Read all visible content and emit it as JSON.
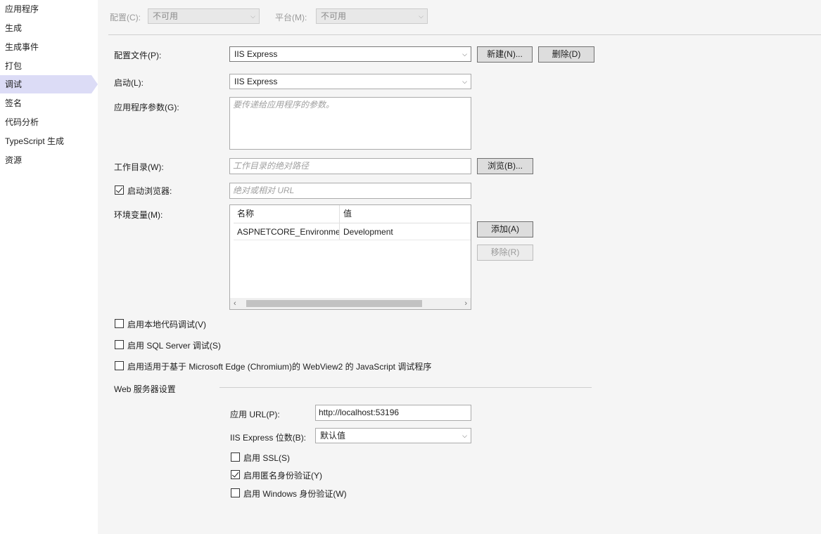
{
  "sidebar": {
    "items": [
      {
        "label": "应用程序"
      },
      {
        "label": "生成"
      },
      {
        "label": "生成事件"
      },
      {
        "label": "打包"
      },
      {
        "label": "调试",
        "active": true
      },
      {
        "label": "签名"
      },
      {
        "label": "代码分析"
      },
      {
        "label": "TypeScript 生成"
      },
      {
        "label": "资源"
      }
    ]
  },
  "top": {
    "config_label": "配置(C):",
    "config_value": "不可用",
    "platform_label": "平台(M):",
    "platform_value": "不可用"
  },
  "profile": {
    "label": "配置文件(P):",
    "value": "IIS Express",
    "new_button": "新建(N)...",
    "delete_button": "删除(D)"
  },
  "launch": {
    "label": "启动(L):",
    "value": "IIS Express"
  },
  "app_args": {
    "label": "应用程序参数(G):",
    "placeholder": "要传递给应用程序的参数。"
  },
  "working_dir": {
    "label": "工作目录(W):",
    "placeholder": "工作目录的绝对路径",
    "browse_button": "浏览(B)..."
  },
  "launch_browser": {
    "label": "启动浏览器:",
    "checked": true,
    "placeholder": "绝对或相对 URL"
  },
  "env_vars": {
    "label": "环境变量(M):",
    "columns": [
      "名称",
      "值"
    ],
    "rows": [
      [
        "ASPNETCORE_Environment",
        "Development"
      ]
    ],
    "add_button": "添加(A)",
    "remove_button": "移除(R)"
  },
  "options": {
    "native_debug": "启用本地代码调试(V)",
    "sql_debug": "启用 SQL Server 调试(S)",
    "webview2_debug": "启用适用于基于 Microsoft Edge (Chromium)的 WebView2 的 JavaScript 调试程序"
  },
  "web_server": {
    "section_title": "Web 服务器设置",
    "app_url_label": "应用 URL(P):",
    "app_url_value": "http://localhost:53196",
    "bitness_label": "IIS Express 位数(B):",
    "bitness_value": "默认值",
    "enable_ssl": "启用 SSL(S)",
    "enable_ssl_checked": false,
    "anon_auth": "启用匿名身份验证(Y)",
    "anon_auth_checked": true,
    "windows_auth": "启用 Windows 身份验证(W)",
    "windows_auth_checked": false
  }
}
